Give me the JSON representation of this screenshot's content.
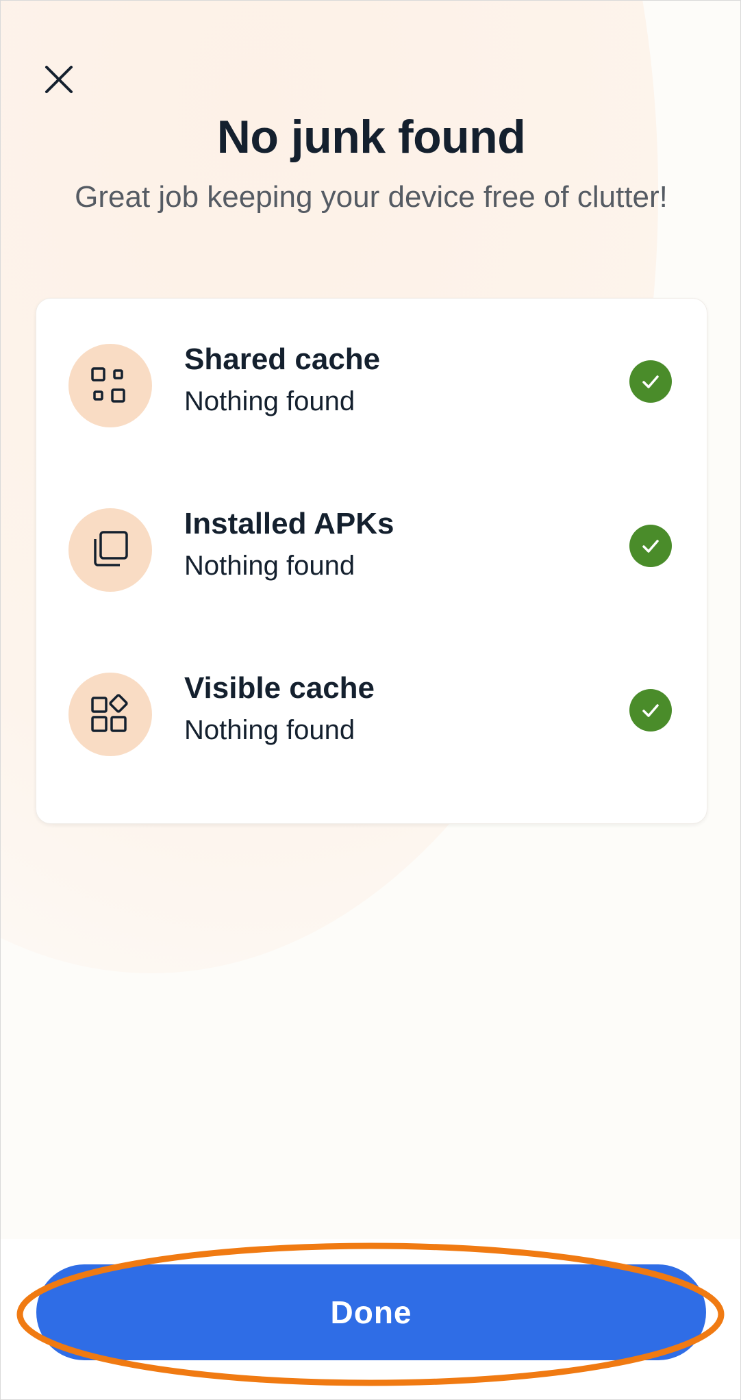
{
  "header": {
    "close_icon": "close-icon",
    "title": "No junk found",
    "subtitle": "Great job keeping your device free of clutter!"
  },
  "results": [
    {
      "icon": "shared-cache-icon",
      "title": "Shared cache",
      "status": "Nothing found",
      "check_icon": "check-icon"
    },
    {
      "icon": "installed-apks-icon",
      "title": "Installed APKs",
      "status": "Nothing found",
      "check_icon": "check-icon"
    },
    {
      "icon": "visible-cache-icon",
      "title": "Visible cache",
      "status": "Nothing found",
      "check_icon": "check-icon"
    }
  ],
  "footer": {
    "done_label": "Done"
  },
  "colors": {
    "accent": "#2f6de6",
    "success": "#4a8c2a",
    "icon_background": "#f9dcc4",
    "highlight_ring": "#f07a12"
  }
}
